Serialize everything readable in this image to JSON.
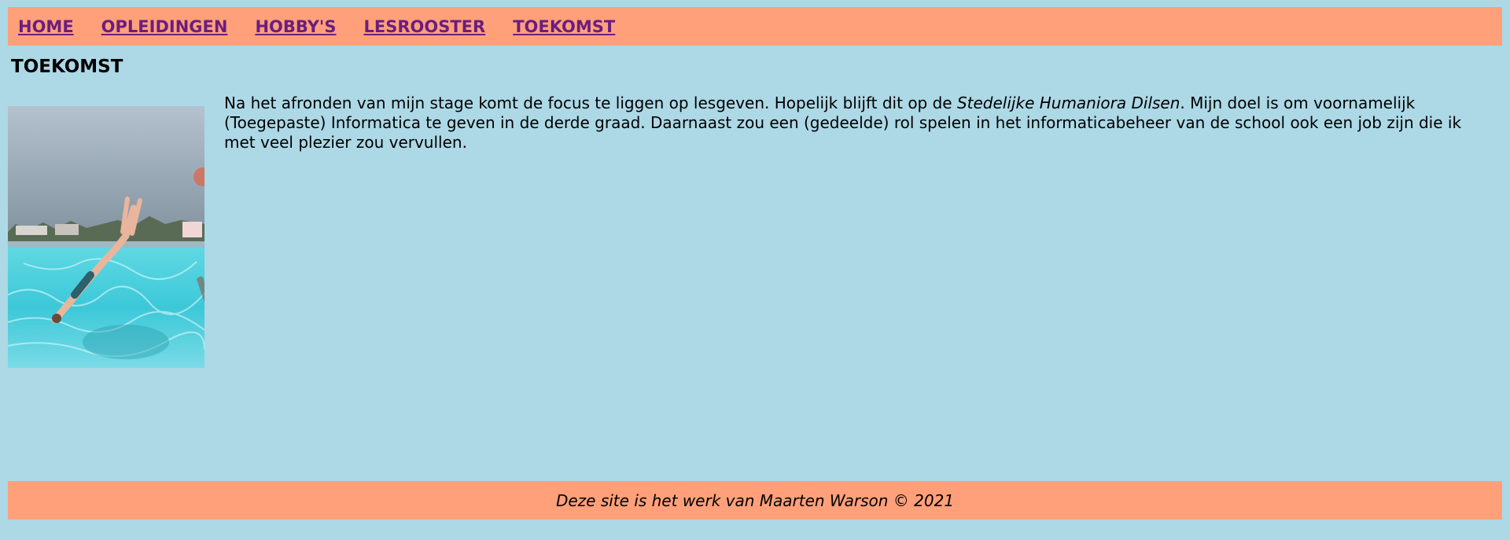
{
  "nav": {
    "items": [
      {
        "label": "HOME"
      },
      {
        "label": "OPLEIDINGEN"
      },
      {
        "label": "HOBBY'S"
      },
      {
        "label": "LESROOSTER"
      },
      {
        "label": "TOEKOMST"
      }
    ]
  },
  "page": {
    "title": "TOEKOMST"
  },
  "content": {
    "text_before": "Na het afronden van mijn stage komt de focus te liggen op lesgeven. Hopelijk blijft dit op de ",
    "school_name": "Stedelijke Humaniora Dilsen",
    "text_after": ". Mijn doel is om voornamelijk (Toegepaste) Informatica te geven in de derde graad. Daarnaast zou een (gedeelde) rol spelen in het informaticabeheer van de school ook een job zijn die ik met veel plezier zou vervullen."
  },
  "footer": {
    "text": "Deze site is het werk van Maarten Warson © 2021"
  },
  "colors": {
    "background": "#add8e6",
    "bar": "#ffa07a",
    "link": "#6b1d7f"
  }
}
